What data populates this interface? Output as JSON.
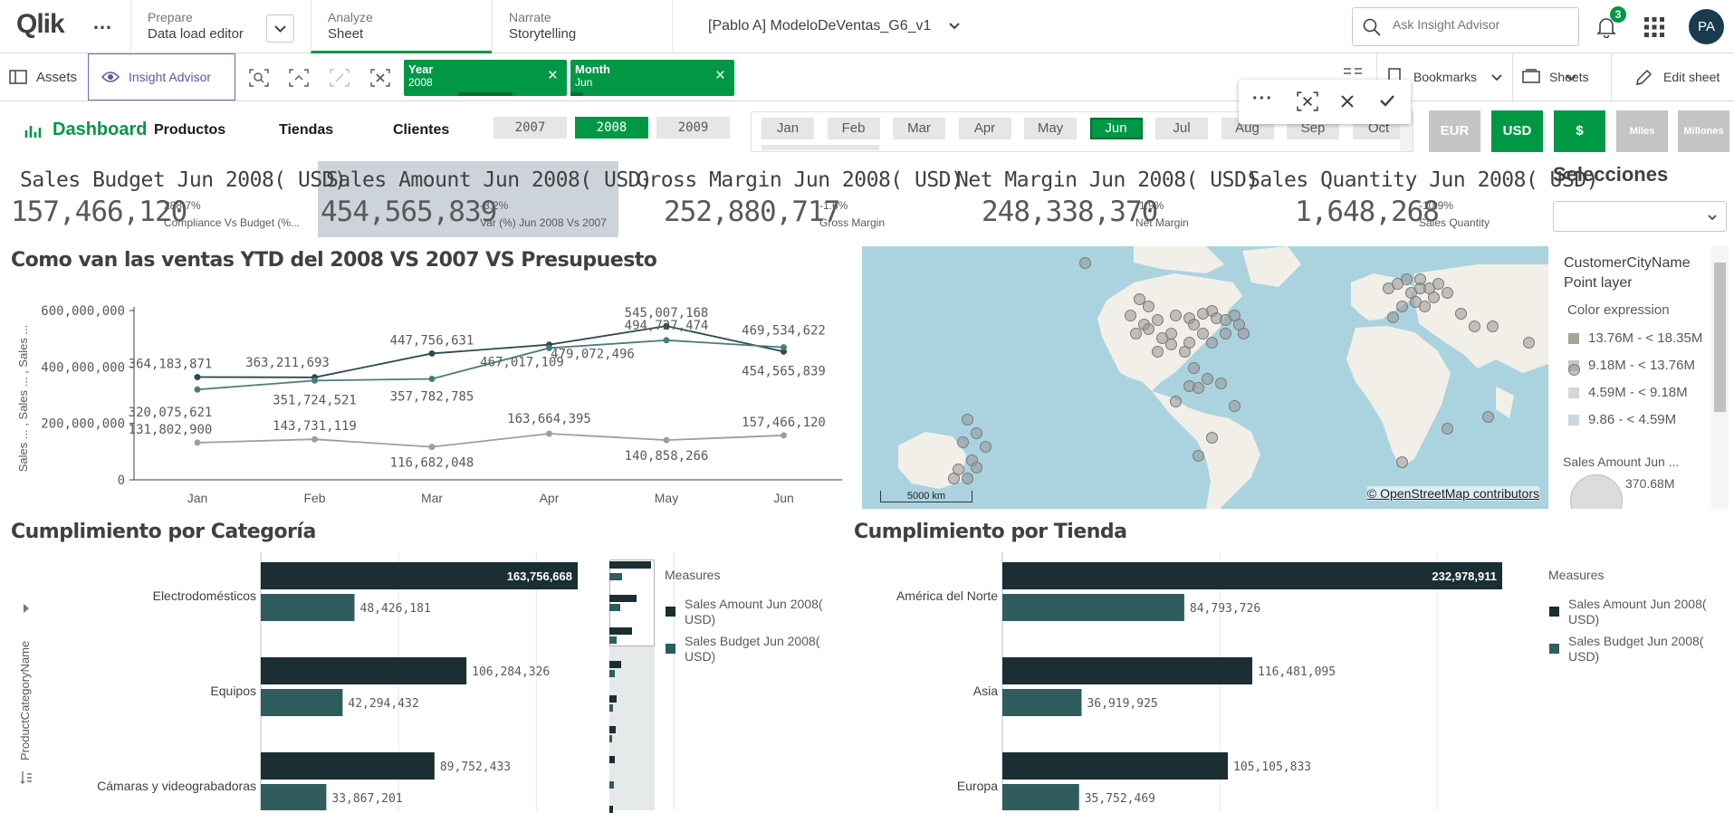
{
  "nav": {
    "logo": "Qlik",
    "more": "…",
    "prepare_label": "Prepare",
    "prepare_value": "Data load editor",
    "analyze_label": "Analyze",
    "analyze_value": "Sheet",
    "narrate_label": "Narrate",
    "narrate_value": "Storytelling",
    "app_title": "[Pablo A] ModeloDeVentas_G6_v1",
    "search_placeholder": "Ask Insight Advisor",
    "notif_count": "3",
    "avatar": "PA"
  },
  "toolbar": {
    "assets": "Assets",
    "insight": "Insight Advisor",
    "bookmarks": "Bookmarks",
    "sheets": "Sheets",
    "edit": "Edit sheet"
  },
  "selections": [
    {
      "field": "Year",
      "value": "2008"
    },
    {
      "field": "Month",
      "value": "Jun"
    }
  ],
  "tabs": {
    "dashboard": "Dashboard",
    "productos": "Productos",
    "tiendas": "Tiendas",
    "clientes": "Clientes"
  },
  "years": [
    "2007",
    "2008",
    "2009"
  ],
  "selected_year": "2008",
  "months": [
    "Jan",
    "Feb",
    "Mar",
    "Apr",
    "May",
    "Jun",
    "Jul",
    "Aug",
    "Sep",
    "Oct"
  ],
  "selected_month": "Jun",
  "currency": [
    "EUR",
    "USD",
    "$",
    "Miles",
    "Millones"
  ],
  "kpis": [
    {
      "title": "Sales Budget Jun 2008( USD)",
      "value": "157,466,120",
      "pct": "288.7%",
      "sub": "Compliance Vs Budget (%..."
    },
    {
      "title": "Sales Amount Jun 2008( USD)",
      "value": "454,565,839",
      "pct": "-3.2%",
      "sub": "Var (%) Jun 2008 Vs 2007"
    },
    {
      "title": "Gross Margin Jun 2008( USD)",
      "value": "252,880,717",
      "pct": "-1.6%",
      "sub": "Gross Margin"
    },
    {
      "title": "Net Margin Jun 2008( USD)",
      "value": "248,338,370",
      "pct": "-1.9%",
      "sub": "Net Margin"
    },
    {
      "title": "Sales Quantity Jun 2008( USD)",
      "value": "1,648,268",
      "pct": "-10.9%",
      "sub": "Sales Quantity"
    }
  ],
  "selecciones_title": "Selecciones",
  "line_title": "Como van las ventas YTD del 2008 VS 2007 VS Presupuesto",
  "map": {
    "legend_title": "CustomerCityName",
    "legend_sub": "Point layer",
    "color_expr": "Color expression",
    "ranges": [
      "13.76M - < 18.35M",
      "9.18M - < 13.76M",
      "4.59M - < 9.18M",
      "9.86 - < 4.59M"
    ],
    "size_title": "Sales Amount Jun ...",
    "size_value": "370.68M",
    "scale": "5000 km",
    "attribution": "© OpenStreetMap contributors"
  },
  "cat_title": "Cumplimiento por Categoría",
  "tienda_title": "Cumplimiento por Tienda",
  "cat_axis": "ProductCategoryName",
  "measures_title": "Measures",
  "legend_items": [
    "Sales Amount Jun 2008( USD)",
    "Sales Budget Jun 2008( USD)"
  ],
  "colors": {
    "accent": "#009845",
    "dark": "#1a2e33",
    "teal": "#2f5d5d",
    "grey": "#999999"
  },
  "chart_data": [
    {
      "type": "line",
      "title": "Como van las ventas YTD del 2008 VS 2007 VS Presupuesto",
      "ylabel": "Sales ... , Sales ... , Sales ...",
      "categories": [
        "Jan",
        "Feb",
        "Mar",
        "Apr",
        "May",
        "Jun"
      ],
      "ylim": [
        0,
        600000000
      ],
      "yticks": [
        "0",
        "200,000,000",
        "400,000,000",
        "600,000,000"
      ],
      "series": [
        {
          "values": [
            364183871,
            363211693,
            447756631,
            479072496,
            545007168,
            454565839
          ],
          "labels": [
            "364,183,871",
            "363,211,693",
            "447,756,631",
            "479,072,496",
            "545,007,168",
            "454,565,839"
          ]
        },
        {
          "values": [
            320075621,
            351724521,
            357782785,
            467017109,
            494727474,
            469534622
          ],
          "labels": [
            "320,075,621",
            "351,724,521",
            "357,782,785",
            "467,017,109",
            "494,727,474",
            "469,534,622"
          ]
        },
        {
          "values": [
            131802900,
            143731119,
            116682048,
            163664395,
            140858266,
            157466120
          ],
          "labels": [
            "131,802,900",
            "143,731,119",
            "116,682,048",
            "163,664,395",
            "140,858,266",
            "157,466,120"
          ]
        }
      ]
    },
    {
      "type": "bar",
      "title": "Cumplimiento por Categoría",
      "categories": [
        "Electrodomésticos",
        "Equipos",
        "Cámaras y videograbadoras"
      ],
      "series": [
        {
          "name": "Sales Amount Jun 2008( USD)",
          "values": [
            163756668,
            106284326,
            89752433
          ],
          "labels": [
            "163,756,668",
            "106,284,326",
            "89,752,433"
          ]
        },
        {
          "name": "Sales Budget Jun 2008( USD)",
          "values": [
            48426181,
            42294432,
            33867201
          ],
          "labels": [
            "48,426,181",
            "42,294,432",
            "33,867,201"
          ]
        }
      ]
    },
    {
      "type": "bar",
      "title": "Cumplimiento por Tienda",
      "categories": [
        "América del Norte",
        "Asia",
        "Europa"
      ],
      "series": [
        {
          "name": "Sales Amount Jun 2008( USD)",
          "values": [
            232978911,
            116481095,
            105105833
          ],
          "labels": [
            "232,978,911",
            "116,481,095",
            "105,105,833"
          ]
        },
        {
          "name": "Sales Budget Jun 2008( USD)",
          "values": [
            84793726,
            36919925,
            35752469
          ],
          "labels": [
            "84,793,726",
            "36,919,925",
            "35,752,469"
          ]
        }
      ]
    }
  ]
}
